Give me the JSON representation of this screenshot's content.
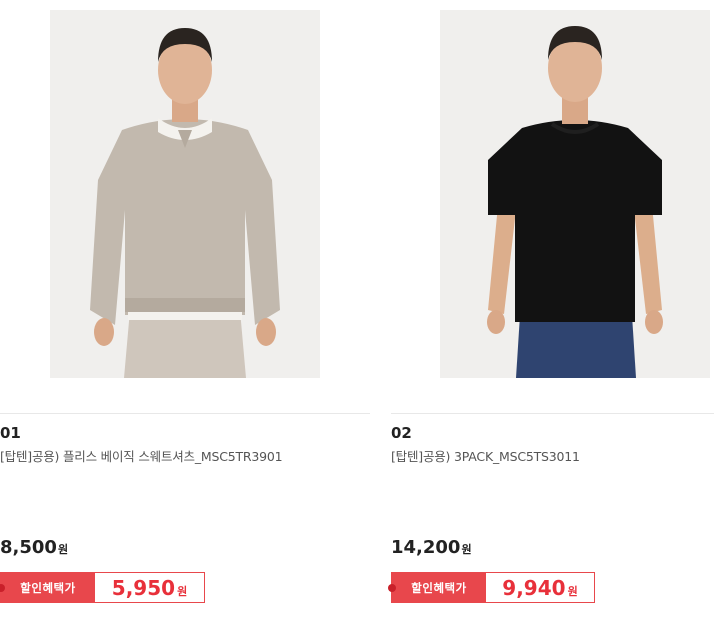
{
  "products": [
    {
      "rank": "01",
      "name": "[탑텐]공용) 플리스 베이직 스웨트셔츠_MSC5TR3901",
      "price": "8,500",
      "price_unit": "원",
      "promo_label": "할인혜택가",
      "sale_price": "5,950",
      "sale_unit": "원",
      "image": "model-grey-sweatshirt"
    },
    {
      "rank": "02",
      "name": "[탑텐]공용) 3PACK_MSC5TS3011",
      "price": "14,200",
      "price_unit": "원",
      "promo_label": "할인혜택가",
      "sale_price": "9,940",
      "sale_unit": "원",
      "image": "model-black-tshirt"
    }
  ],
  "colors": {
    "accent": "#e8474c",
    "sale_price": "#e8303a",
    "thumb_bg": "#f0f0f0"
  }
}
